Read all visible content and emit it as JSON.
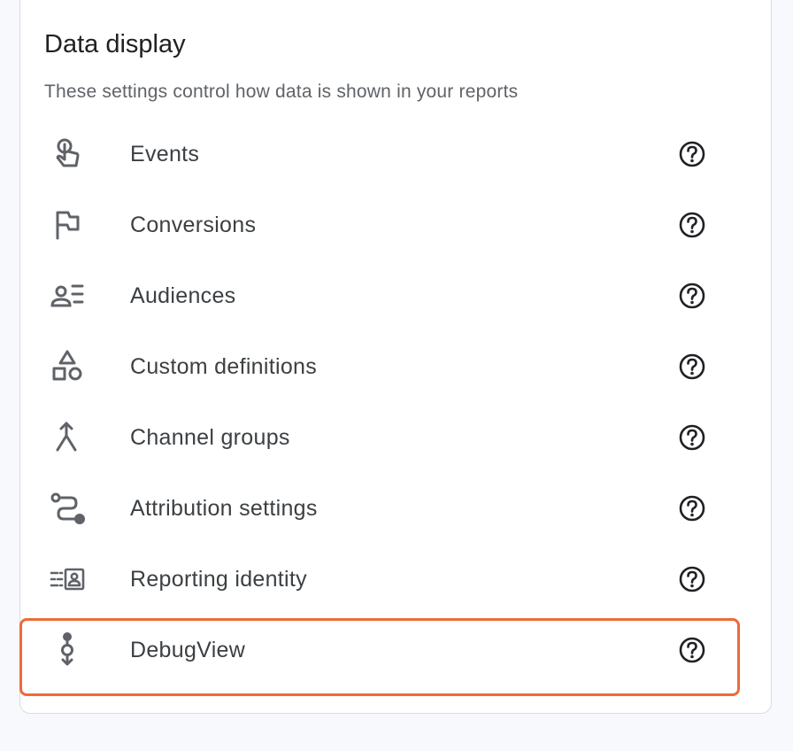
{
  "section": {
    "title": "Data display",
    "subtitle": "These settings control how data is shown in your reports"
  },
  "items": [
    {
      "label": "Events",
      "icon": "touch-icon"
    },
    {
      "label": "Conversions",
      "icon": "flag-icon"
    },
    {
      "label": "Audiences",
      "icon": "audience-list-icon"
    },
    {
      "label": "Custom definitions",
      "icon": "shapes-icon"
    },
    {
      "label": "Channel groups",
      "icon": "merge-arrow-icon"
    },
    {
      "label": "Attribution settings",
      "icon": "route-icon"
    },
    {
      "label": "Reporting identity",
      "icon": "identity-badge-icon"
    },
    {
      "label": "DebugView",
      "icon": "debug-timeline-icon",
      "highlighted": true
    }
  ],
  "colors": {
    "highlight_border": "#ed6a3a",
    "icon": "#5f6368",
    "text": "#3c4043"
  }
}
